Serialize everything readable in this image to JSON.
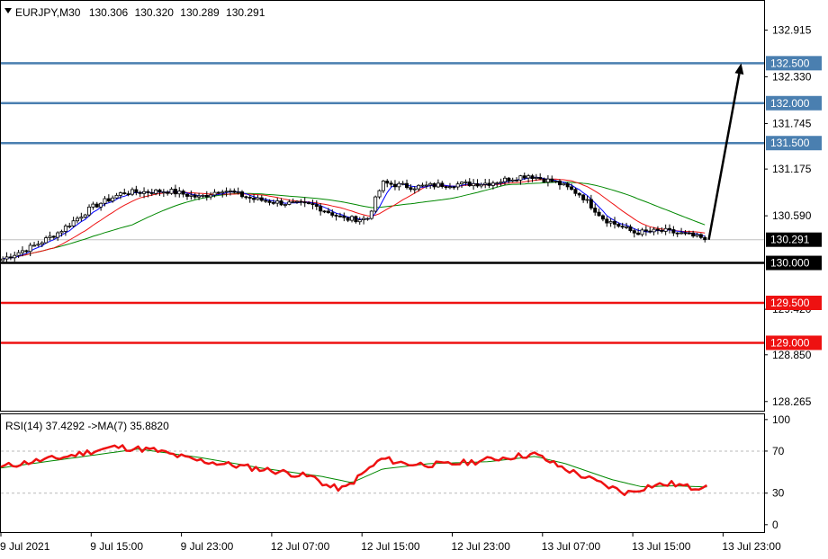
{
  "chart_data": [
    {
      "type": "candlestick",
      "header": {
        "symbol": "EURJPY,M30",
        "open": "130.306",
        "high": "130.320",
        "low": "130.289",
        "close": "130.291"
      },
      "price_axis": {
        "range": [
          128.15,
          133.28
        ],
        "tick_labels": [
          "132.915",
          "132.330",
          "131.745",
          "131.175",
          "130.590",
          "129.420",
          "128.850",
          "128.265"
        ],
        "current_price": "130.291"
      },
      "time_axis": {
        "labels": [
          "9 Jul 2021",
          "9 Jul 15:00",
          "9 Jul 23:00",
          "12 Jul 07:00",
          "12 Jul 15:00",
          "12 Jul 23:00",
          "13 Jul 07:00",
          "13 Jul 15:00",
          "13 Jul 23:00"
        ]
      },
      "levels": [
        {
          "value": 132.5,
          "label": "132.500",
          "color": "#4a7fb0"
        },
        {
          "value": 132.0,
          "label": "132.000",
          "color": "#4a7fb0"
        },
        {
          "value": 131.5,
          "label": "131.500",
          "color": "#4a7fb0"
        },
        {
          "value": 130.0,
          "label": "130.000",
          "color": "#000000"
        },
        {
          "value": 129.5,
          "label": "129.500",
          "color": "#ee1111"
        },
        {
          "value": 129.0,
          "label": "129.000",
          "color": "#ee1111"
        }
      ],
      "price_keypoints": [
        [
          0,
          130.04
        ],
        [
          0.045,
          130.22
        ],
        [
          0.075,
          130.38
        ],
        [
          0.12,
          130.7
        ],
        [
          0.16,
          130.88
        ],
        [
          0.22,
          130.9
        ],
        [
          0.26,
          130.82
        ],
        [
          0.29,
          130.92
        ],
        [
          0.33,
          130.8
        ],
        [
          0.37,
          130.75
        ],
        [
          0.41,
          130.72
        ],
        [
          0.45,
          130.55
        ],
        [
          0.48,
          130.55
        ],
        [
          0.5,
          131.0
        ],
        [
          0.54,
          130.95
        ],
        [
          0.58,
          130.98
        ],
        [
          0.64,
          131.0
        ],
        [
          0.69,
          131.1
        ],
        [
          0.73,
          131.0
        ],
        [
          0.76,
          130.85
        ],
        [
          0.79,
          130.55
        ],
        [
          0.83,
          130.38
        ],
        [
          0.87,
          130.4
        ],
        [
          0.9,
          130.35
        ],
        [
          0.925,
          130.29
        ]
      ],
      "ma_fast_color": "#0000ff",
      "ma_mid_color": "#ee1111",
      "ma_slow_color": "#008800",
      "arrow": {
        "from": {
          "x": 0.9275,
          "y": 130.29
        },
        "to": {
          "x": 0.97,
          "y": 132.5
        },
        "color": "#000000"
      }
    },
    {
      "type": "line",
      "header": "RSI(14) 37.4292  ->MA(7) 35.8820",
      "ylim": [
        -7,
        105
      ],
      "tick_labels": [
        "100",
        "70",
        "30",
        "0"
      ],
      "levels": [
        70,
        30
      ],
      "series": [
        {
          "color": "#ee1111",
          "keypoints": [
            [
              0,
              55
            ],
            [
              0.04,
              60
            ],
            [
              0.08,
              64
            ],
            [
              0.12,
              70
            ],
            [
              0.15,
              74
            ],
            [
              0.2,
              71
            ],
            [
              0.25,
              62
            ],
            [
              0.29,
              58
            ],
            [
              0.33,
              54
            ],
            [
              0.37,
              50
            ],
            [
              0.41,
              45
            ],
            [
              0.43,
              36
            ],
            [
              0.45,
              34
            ],
            [
              0.48,
              52
            ],
            [
              0.5,
              63
            ],
            [
              0.53,
              58
            ],
            [
              0.58,
              57
            ],
            [
              0.62,
              60
            ],
            [
              0.66,
              64
            ],
            [
              0.7,
              67
            ],
            [
              0.73,
              56
            ],
            [
              0.76,
              47
            ],
            [
              0.79,
              38
            ],
            [
              0.82,
              30
            ],
            [
              0.85,
              37
            ],
            [
              0.88,
              39
            ],
            [
              0.905,
              35
            ],
            [
              0.925,
              37.4292
            ]
          ]
        },
        {
          "color": "#008800",
          "keypoints": [
            [
              0,
              54
            ],
            [
              0.1,
              64
            ],
            [
              0.18,
              72
            ],
            [
              0.26,
              64
            ],
            [
              0.34,
              54
            ],
            [
              0.42,
              46
            ],
            [
              0.46,
              40
            ],
            [
              0.5,
              53
            ],
            [
              0.56,
              58
            ],
            [
              0.64,
              60
            ],
            [
              0.7,
              65
            ],
            [
              0.74,
              58
            ],
            [
              0.8,
              43
            ],
            [
              0.84,
              36
            ],
            [
              0.88,
              37
            ],
            [
              0.925,
              35.882
            ]
          ]
        }
      ]
    }
  ]
}
